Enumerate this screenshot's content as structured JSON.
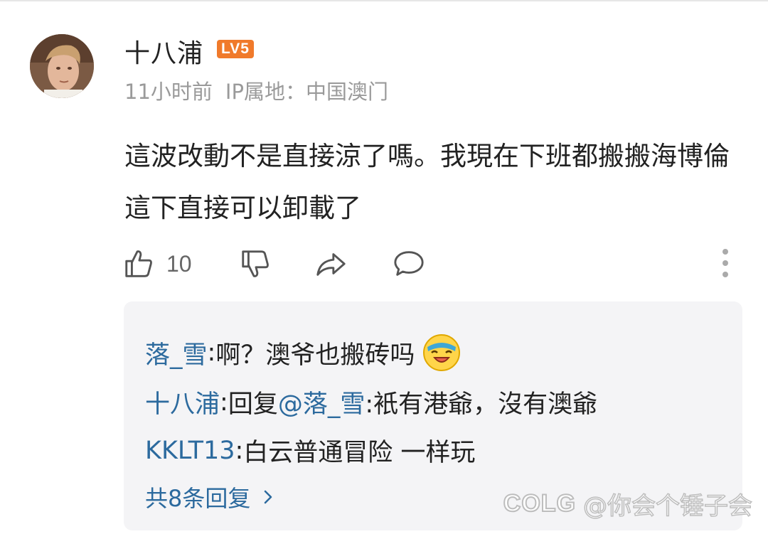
{
  "comment": {
    "author": "十八浦",
    "level_badge": "LV5",
    "time": "11小时前",
    "ip_location": "IP属地：中国澳门",
    "text": "這波改動不是直接涼了嗎。我現在下班都搬搬海博倫 這下直接可以卸載了",
    "like_count": "10"
  },
  "icons": [
    "like-icon",
    "dislike-icon",
    "share-icon",
    "comment-icon",
    "more-icon",
    "chevron-right-icon",
    "laughing-emoji-icon"
  ],
  "replies": [
    {
      "name": "落_雪",
      "sep": ": ",
      "text": "啊？澳爷也搬砖吗"
    },
    {
      "name": "十八浦",
      "sep": ": ",
      "prefix": "回复 ",
      "mention": "@落_雪",
      "text": " :衹有港爺，沒有澳爺"
    },
    {
      "name": "KKLT13",
      "sep": ": ",
      "text": "白云普通冒险 一样玩"
    }
  ],
  "total_replies": "共8条回复",
  "watermark": {
    "logo": "COLG",
    "text": "@你会个锤子会"
  },
  "colors": {
    "level_badge": "#f07a2b",
    "reply_name": "#2c6a9e",
    "meta": "#9a9a9a",
    "reply_bg": "#f4f4f6"
  }
}
